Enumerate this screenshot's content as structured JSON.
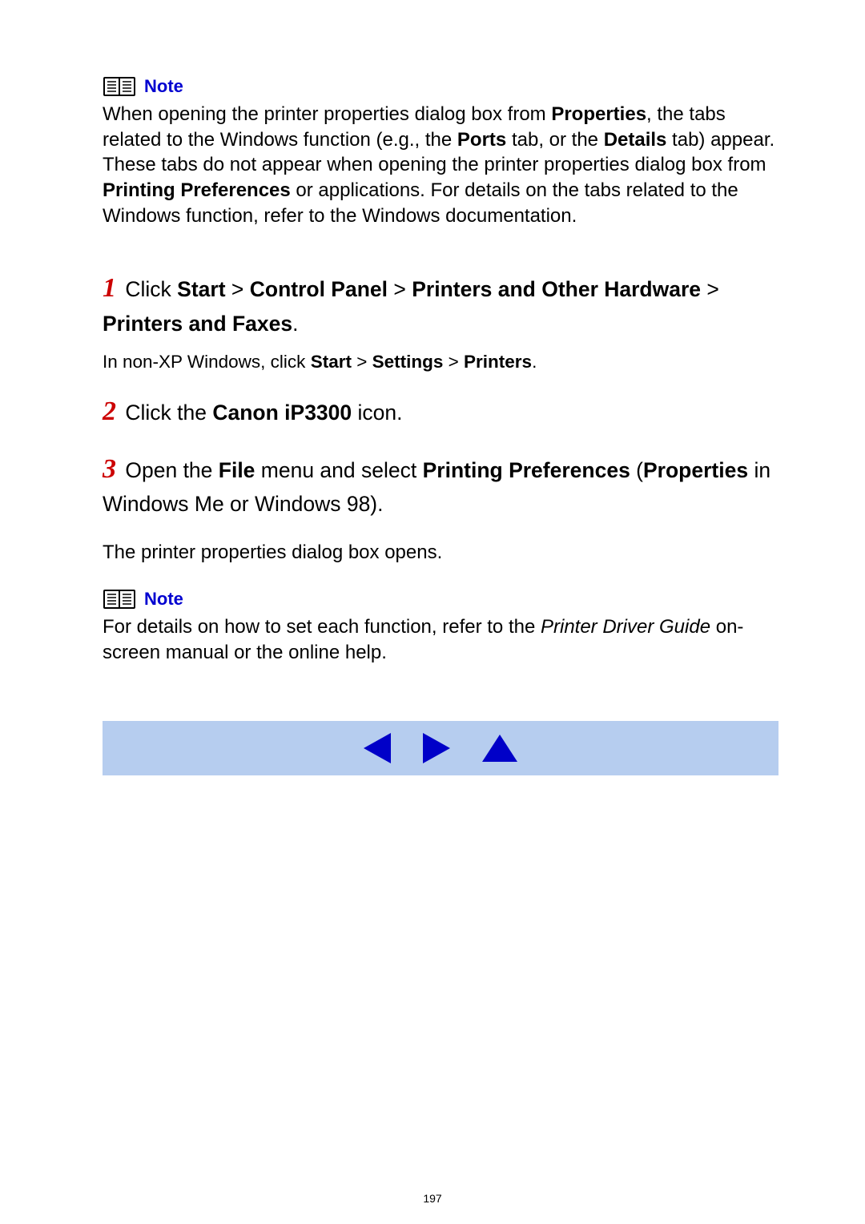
{
  "note1": {
    "label": "Note",
    "body_html": "When opening the printer properties dialog box from <b>Properties</b>, the tabs related to the Windows function (e.g., the <b>Ports</b> tab, or the <b>Details</b> tab) appear. These tabs do not appear when opening the printer properties dialog box from <b>Printing Preferences</b> or applications. For details on the tabs related to the Windows function, refer to the Windows documentation."
  },
  "steps": [
    {
      "num": "1",
      "main_html": "Click <b>Start</b> > <b>Control Panel</b> > <b>Printers and Other Hardware</b> > <b>Printers and Faxes</b>.",
      "sub_html": "In non-XP Windows, click <b>Start</b> > <b>Settings</b> > <b>Printers</b>."
    },
    {
      "num": "2",
      "main_html": "Click the <b>Canon iP3300</b> icon."
    },
    {
      "num": "3",
      "main_html": "Open the <b>File</b> menu and select <b>Printing Preferences</b> (<b>Properties</b> in Windows Me or Windows 98).",
      "result": "The printer properties dialog box opens."
    }
  ],
  "note2": {
    "label": "Note",
    "body_html": "For details on how to set each function, refer to the <i class='guide'>Printer Driver Guide</i> on-screen manual or the online help."
  },
  "nav": {
    "prev": "previous",
    "next": "next",
    "up": "top"
  },
  "page_number": "197"
}
